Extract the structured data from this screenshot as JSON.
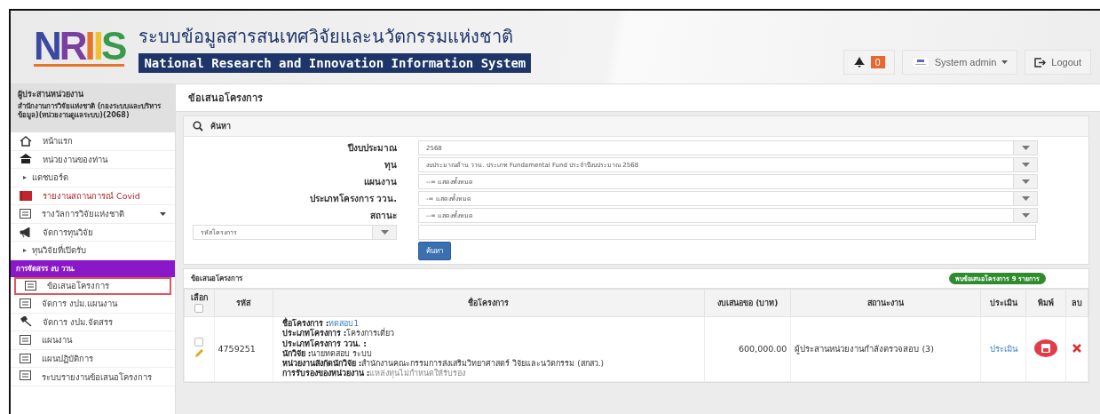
{
  "header": {
    "logo": [
      {
        "text": "N",
        "color": "#3b4aa0"
      },
      {
        "text": "R",
        "color": "#7b3fa0"
      },
      {
        "text": "I",
        "color": "#e8742a"
      },
      {
        "text": "I",
        "color": "#f2c12e"
      },
      {
        "text": "S",
        "color": "#3a9a4a"
      }
    ],
    "title_th": "ระบบข้อมูลสารสนเทศวิจัยและนวัตกรรมแห่งชาติ",
    "title_en": "National Research and Innovation Information System",
    "notifications": "0",
    "user": "System admin",
    "logout": "Logout"
  },
  "sidebar": {
    "role": "ผู้ประสานหน่วยงาน",
    "org": "สำนักงานการวิจัยแห่งชาติ (กองระบบและบริหารข้อมูล)(หน่วยงานดูแลระบบ)(2068)",
    "items": [
      {
        "kind": "home",
        "label": "หน้าแรก",
        "selected": false
      },
      {
        "kind": "building",
        "label": "หน่วยงานของท่าน",
        "selected": false
      },
      {
        "kind": "bullet",
        "label": "แดชบอร์ด",
        "selected": false
      },
      {
        "kind": "alert",
        "label": "รายงานสถานการณ์ Covid",
        "selected": false
      },
      {
        "kind": "dropdown",
        "label": "รางวัลการวิจัยแห่งชาติ",
        "selected": false
      },
      {
        "kind": "megaphone",
        "label": "จัดการทุนวิจัย",
        "selected": false
      },
      {
        "kind": "bullet",
        "label": "ทุนวิจัยที่เปิดรับ",
        "selected": false
      },
      {
        "kind": "section",
        "label": "การจัดสรร งบ ววน.",
        "selected": false
      },
      {
        "kind": "doc",
        "label": "ข้อเสนอโครงการ",
        "selected": true
      },
      {
        "kind": "doc",
        "label": "จัดการ งปม.แผนงาน",
        "selected": false
      },
      {
        "kind": "gavel",
        "label": "จัดการ งปม.จัดสรร",
        "selected": false
      },
      {
        "kind": "doc",
        "label": "แผนงาน",
        "selected": false
      },
      {
        "kind": "doc",
        "label": "แผนปฏิบัติการ",
        "selected": false
      },
      {
        "kind": "doc",
        "label": "ระบบรายงานข้อเสนอโครงการ",
        "selected": false
      }
    ]
  },
  "page_title": "ข้อเสนอโครงการ",
  "search": {
    "title": "ค้นหา",
    "fields": [
      {
        "label": "ปีงบประมาณ",
        "value": "2568"
      },
      {
        "label": "ทุน",
        "value": "งบประมาณด้าน ววน. ประเภท Fundamental Fund ประจำปีงบประมาณ 2568"
      },
      {
        "label": "แผนงาน",
        "value": "--= แสดงทั้งหมด"
      },
      {
        "label": "ประเภทโครงการ ววน.",
        "value": "-= แสดงทั้งหมด"
      },
      {
        "label": "สถานะ",
        "value": "--= แสดงทั้งหมด"
      }
    ],
    "key_select": "รหัสโครงการ",
    "button": "ค้นหา"
  },
  "results": {
    "title": "ข้อเสนอโครงการ",
    "count": "พบข้อเสนอโครงการ 9 รายการ",
    "columns": [
      "เลือก",
      "รหัส",
      "ชื่อโครงการ",
      "งบเสนอขอ (บาท)",
      "สถานะงาน",
      "ประเมิน",
      "พิมพ์",
      "ลบ"
    ],
    "select_all": false,
    "rows": [
      {
        "checked": false,
        "code": "4759251",
        "details": [
          {
            "label": "ชื่อโครงการ :",
            "value": "ทดสอบ1",
            "kind": "link"
          },
          {
            "label": "ประเภทโครงการ :",
            "value": "โครงการเดี่ยว",
            "kind": "text"
          },
          {
            "label": "ประเภทโครงการ ววน. :"
          },
          {
            "label": "นักวิจัย :",
            "value": "นายทดสอบ ระบบ",
            "kind": "text"
          },
          {
            "label": "หน่วยงานสังกัดนักวิจัย :",
            "value": "สำนักงานคณะกรรมการส่งเสริมวิทยาศาสตร์ วิจัยและนวัตกรรม (สกสว.)",
            "kind": "text"
          },
          {
            "label": "การรับรองของหน่วยงาน :",
            "value": "แหล่งทุนไม่กำหนดให้รับรอง",
            "kind": "muted"
          }
        ],
        "budget": "600,000.00",
        "status": "ผู้ประสานหน่วยงานกำลังตรวจสอบ (3)",
        "evaluate": "ประเมิน"
      }
    ]
  }
}
